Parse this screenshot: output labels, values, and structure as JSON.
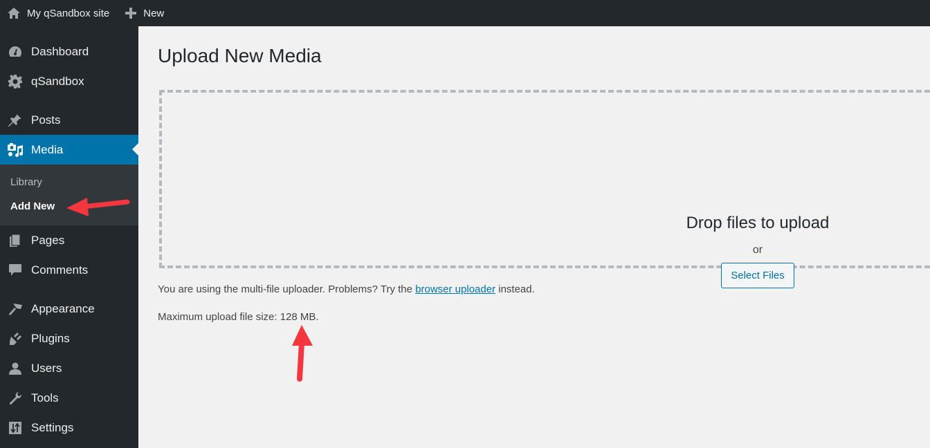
{
  "adminbar": {
    "site_name": "My qSandbox site",
    "new_label": "New",
    "icons": {
      "site": "home-icon",
      "new": "plus-icon"
    }
  },
  "sidebar": {
    "items": [
      {
        "label": "Dashboard",
        "icon": "dashboard-gauge-icon"
      },
      {
        "label": "qSandbox",
        "icon": "gear-icon"
      },
      {
        "label": "Posts",
        "icon": "pushpin-icon"
      },
      {
        "label": "Media",
        "icon": "media-camera-music-icon",
        "active": true
      },
      {
        "label": "Pages",
        "icon": "pages-icon"
      },
      {
        "label": "Comments",
        "icon": "comment-bubble-icon"
      },
      {
        "label": "Appearance",
        "icon": "paintbrush-icon"
      },
      {
        "label": "Plugins",
        "icon": "plug-icon"
      },
      {
        "label": "Users",
        "icon": "user-icon"
      },
      {
        "label": "Tools",
        "icon": "wrench-icon"
      },
      {
        "label": "Settings",
        "icon": "sliders-icon"
      }
    ],
    "media_submenu": [
      {
        "label": "Library"
      },
      {
        "label": "Add New",
        "current": true
      }
    ],
    "active_color": "#0073aa"
  },
  "main": {
    "title": "Upload New Media",
    "dropzone": {
      "title": "Drop files to upload",
      "or": "or",
      "button": "Select Files"
    },
    "uploader_info": {
      "prefix": "You are using the multi-file uploader. Problems? Try the ",
      "link": "browser uploader",
      "suffix": " instead."
    },
    "max_upload": "Maximum upload file size: 128 MB."
  },
  "annotations": {
    "arrow_color": "#f4373f"
  }
}
